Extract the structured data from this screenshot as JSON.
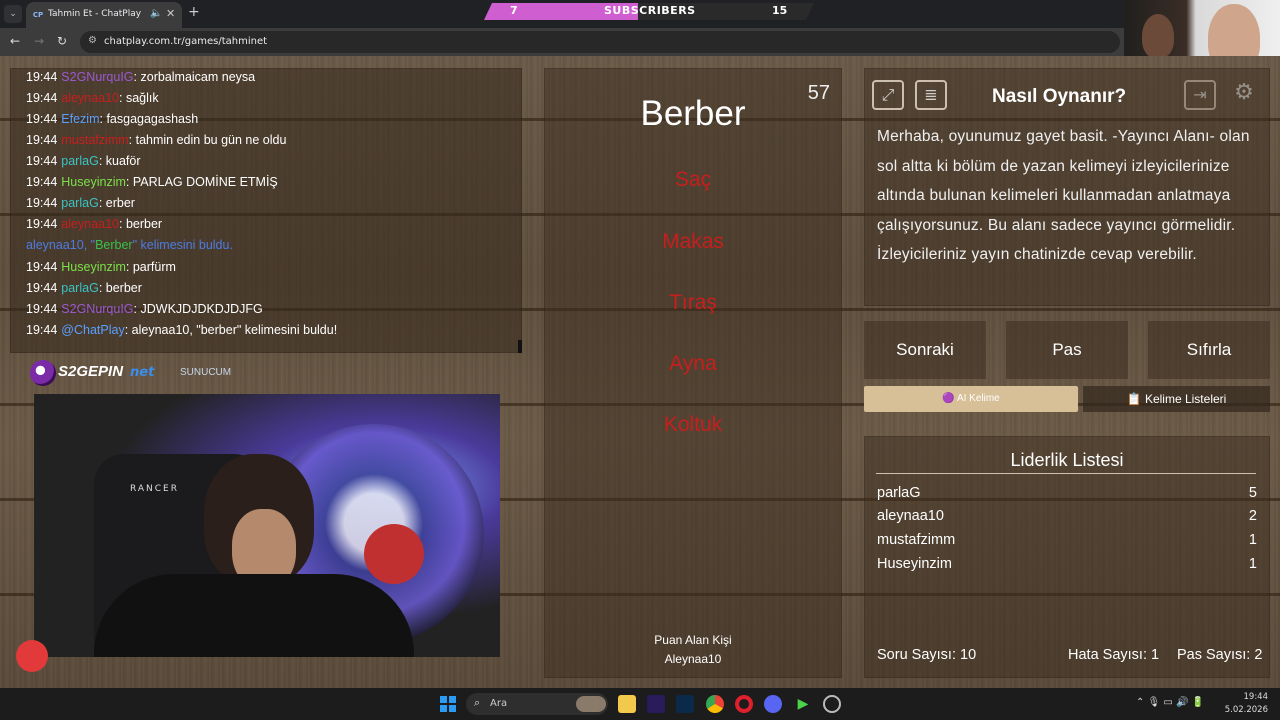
{
  "browser": {
    "tab_favicon": "CP",
    "tab_title": "Tahmin Et - ChatPlay",
    "url": "chatplay.com.tr/games/tahminet"
  },
  "overlay": {
    "subscribers_label": "SUBSCRIBERS",
    "subscribers_current": "7",
    "subscribers_goal": "15",
    "progress_fraction": 0.467
  },
  "chat": [
    {
      "time": "19:44",
      "user": "S2GNurquIG",
      "user_color": "#9b59d0",
      "msg": "zorbalmaicam neysa"
    },
    {
      "time": "19:44",
      "user": "aleynaa10",
      "user_color": "#c81e1e",
      "msg": "sağlık"
    },
    {
      "time": "19:44",
      "user": "Efezim",
      "user_color": "#5aa0ff",
      "msg": "fasgagagashash"
    },
    {
      "time": "19:44",
      "user": "mustafzimm",
      "user_color": "#c81e1e",
      "msg": "tahmin edin bu gün ne oldu"
    },
    {
      "time": "19:44",
      "user": "parlaG",
      "user_color": "#39c4c4",
      "msg": "kuaför"
    },
    {
      "time": "19:44",
      "user": "Huseyinzim",
      "user_color": "#7be04a",
      "msg": "PARLAG DOMİNE ETMİŞ"
    },
    {
      "time": "19:44",
      "user": "parlaG",
      "user_color": "#39c4c4",
      "msg": "erber"
    },
    {
      "time": "19:44",
      "user": "aleynaa10",
      "user_color": "#c81e1e",
      "msg": "berber"
    },
    {
      "time": "",
      "user": "",
      "user_color": "",
      "msg": ""
    },
    {
      "time": "19:44",
      "user": "Huseyinzim",
      "user_color": "#7be04a",
      "msg": "parfürm"
    },
    {
      "time": "19:44",
      "user": "parlaG",
      "user_color": "#39c4c4",
      "msg": "berber"
    },
    {
      "time": "19:44",
      "user": "S2GNurquIG",
      "user_color": "#9b59d0",
      "msg": "JDWKJDJDKDJDJFG"
    },
    {
      "time": "19:44",
      "user": "@ChatPlay",
      "user_color": "#5aa0ff",
      "msg": "aleynaa10, \"berber\" kelimesini buldu!"
    }
  ],
  "chat_system": {
    "prefix": "aleynaa10, \"",
    "word": "Berber",
    "suffix": "\" kelimesini buldu."
  },
  "sponsors": {
    "s2g": "S2GEPIN",
    "net_mark": "net",
    "net": "SUNUCUM"
  },
  "webcam": {
    "chair_label": "RANCER"
  },
  "game": {
    "timer": "57",
    "word": "Berber",
    "forbidden": [
      "Saç",
      "Makas",
      "Tıraş",
      "Ayna",
      "Koltuk"
    ],
    "forbidden_color": "#c81e1e",
    "scorer_label": "Puan Alan Kişi",
    "scorer_name": "Aleynaa10"
  },
  "howto": {
    "title": "Nasıl Oynanır?",
    "text": "Merhaba, oyunumuz gayet basit. -Yayıncı Alanı- olan sol altta ki bölüm de yazan kelimeyi izleyicilerinize altında bulunan kelimeleri kullanmadan anlatmaya çalışıyorsunuz. Bu alanı sadece yayıncı görmelidir. İzleyicileriniz yayın chatinizde cevap verebilir."
  },
  "actions": {
    "next": "Sonraki",
    "pass": "Pas",
    "reset": "Sıfırla",
    "ai_word": "AI Kelime",
    "word_lists": "Kelime Listeleri"
  },
  "leaderboard": {
    "title": "Liderlik Listesi",
    "rows": [
      {
        "name": "parlaG",
        "score": "5"
      },
      {
        "name": "aleynaa10",
        "score": "2"
      },
      {
        "name": "mustafzimm",
        "score": "1"
      },
      {
        "name": "Huseyinzim",
        "score": "1"
      }
    ],
    "question_count": "Soru Sayısı: 10",
    "error_count": "Hata Sayısı: 1",
    "pass_count": "Pas Sayısı: 2"
  },
  "taskbar": {
    "search": "Ara",
    "time": "19:44",
    "date": "5.02.2026"
  },
  "colors": {
    "accent_pink": "#cf5fd1",
    "ai_button": "#d7bf98",
    "forbidden_red": "#c81e1e"
  },
  "icons": [
    "expand-icon",
    "notes-icon",
    "exit-icon",
    "settings-icon"
  ]
}
